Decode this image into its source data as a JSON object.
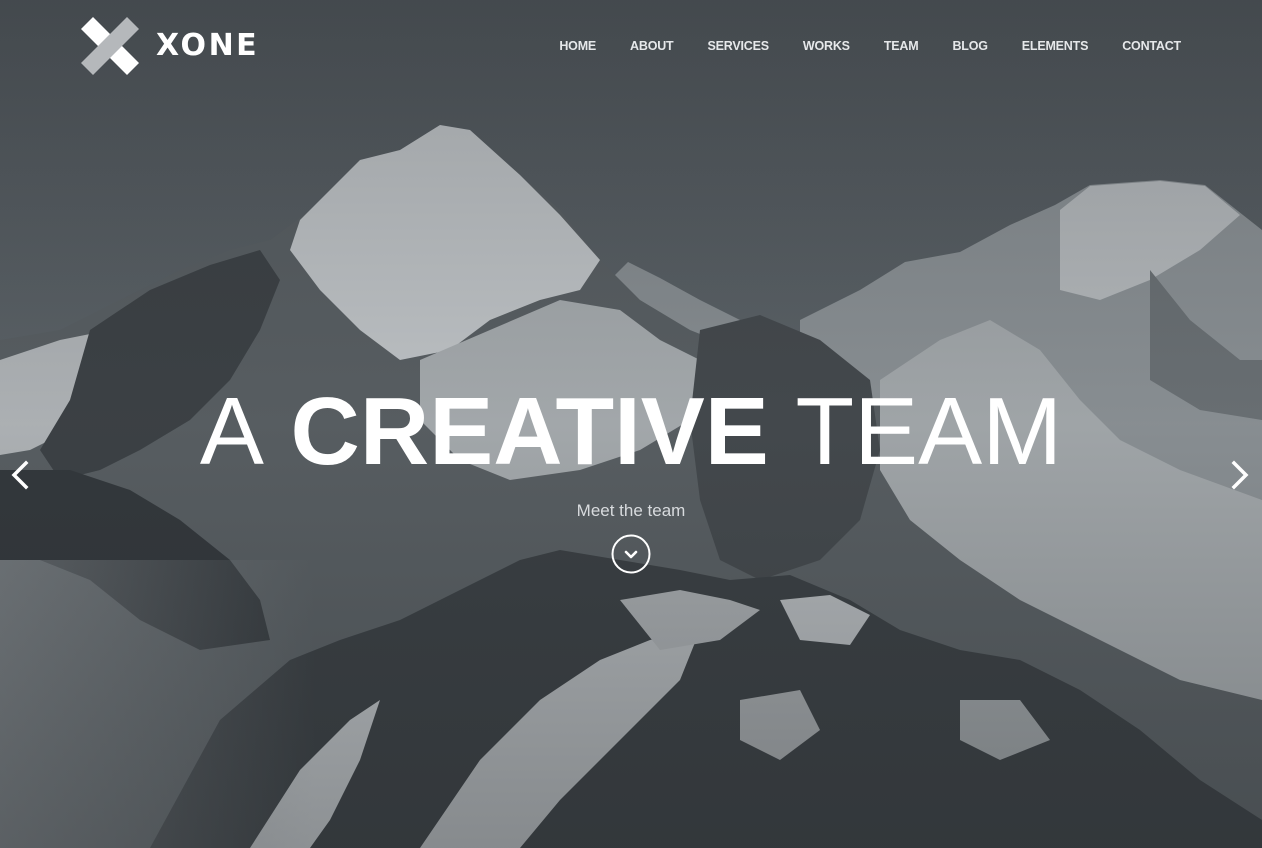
{
  "brand": {
    "name": "XONE",
    "logo_icon": "x-logo-icon"
  },
  "nav": {
    "items": [
      {
        "label": "HOME"
      },
      {
        "label": "ABOUT"
      },
      {
        "label": "SERVICES"
      },
      {
        "label": "WORKS"
      },
      {
        "label": "TEAM"
      },
      {
        "label": "BLOG"
      },
      {
        "label": "ELEMENTS"
      },
      {
        "label": "CONTACT"
      }
    ]
  },
  "hero": {
    "headline_light_1": "A",
    "headline_bold": "CREATIVE",
    "headline_light_2": "TEAM",
    "subtitle": "Meet the team",
    "scroll_icon": "chevron-down-circle-icon",
    "prev_icon": "chevron-left-icon",
    "next_icon": "chevron-right-icon",
    "background": "snowy-mountain-peaks-photo"
  },
  "colors": {
    "text": "#ffffff",
    "overlay": "#3a3f44",
    "logo_light": "#ffffff",
    "logo_gray": "#b5b8bb"
  }
}
